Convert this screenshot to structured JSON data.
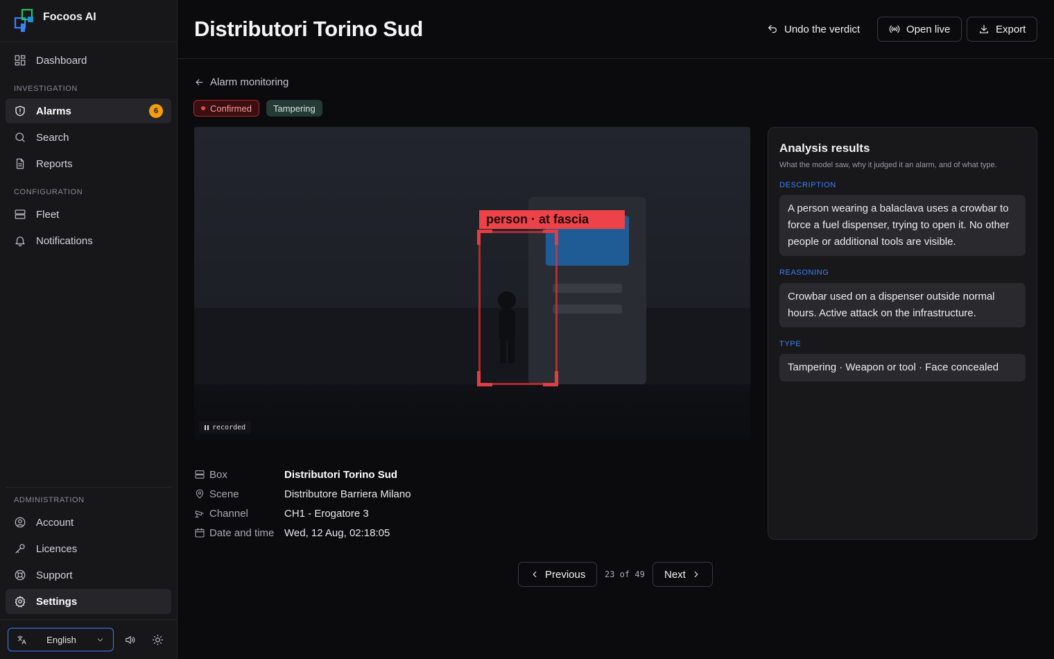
{
  "app": {
    "brand_name": "Focoos AI"
  },
  "sidebar": {
    "dashboard": "Dashboard",
    "investigation_label": "INVESTIGATION",
    "alarms": {
      "label": "Alarms",
      "badge": "6"
    },
    "search": "Search",
    "reports": "Reports",
    "configuration_label": "CONFIGURATION",
    "fleet": "Fleet",
    "notifications": "Notifications",
    "administration_label": "ADMINISTRATION",
    "account": "Account",
    "licences": "Licences",
    "support": "Support",
    "settings": "Settings",
    "language": "English"
  },
  "header": {
    "title": "Distributori Torino Sud",
    "undo_label": "Undo the verdict",
    "open_live_label": "Open live",
    "export_label": "Export"
  },
  "breadcrumb": {
    "back_label": "Alarm monitoring"
  },
  "status": {
    "verdict": "Confirmed",
    "tag": "Tampering"
  },
  "video": {
    "detection_label": "person · at fascia",
    "state_label": "recorded"
  },
  "details": {
    "box": {
      "key": "Box",
      "value": "Distributori Torino Sud"
    },
    "scene": {
      "key": "Scene",
      "value": "Distributore Barriera Milano"
    },
    "channel": {
      "key": "Channel",
      "value": "CH1 - Erogatore 3"
    },
    "datetime": {
      "key": "Date and time",
      "value": "Wed, 12 Aug, 02:18:05"
    }
  },
  "pagination": {
    "previous": "Previous",
    "counter": "23 of 49",
    "next": "Next"
  },
  "analysis": {
    "title": "Analysis results",
    "subtitle": "What the model saw, why it judged it an alarm, and of what type.",
    "description_label": "DESCRIPTION",
    "description": "A person wearing a balaclava uses a crowbar to force a fuel dispenser, trying to open it. No other people or additional tools are visible.",
    "reasoning_label": "REASONING",
    "reasoning": "Crowbar used on a dispenser outside normal hours. Active attack on the infrastructure.",
    "type_label": "TYPE",
    "type": "Tampering · Weapon or tool · Face concealed"
  },
  "colors": {
    "accent": "#3b82f6",
    "badge": "#f59e0b",
    "alert": "#ef4444",
    "tag_bg": "#233a35"
  }
}
